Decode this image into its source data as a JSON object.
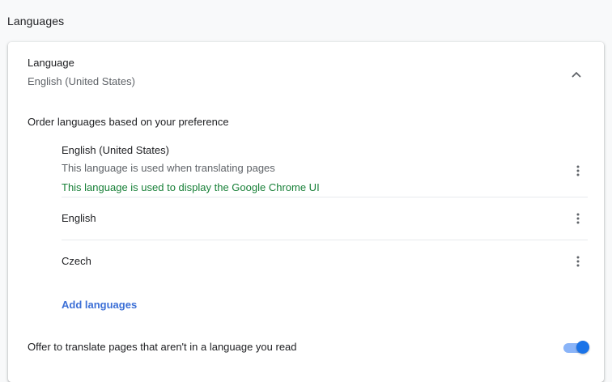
{
  "section": {
    "title": "Languages"
  },
  "language": {
    "label": "Language",
    "current": "English (United States)",
    "collapse_icon": "chevron-up-icon"
  },
  "order": {
    "label": "Order languages based on your preference",
    "items": [
      {
        "name": "English (United States)",
        "desc1": "This language is used when translating pages",
        "desc2": "This language is used to display the Google Chrome UI"
      },
      {
        "name": "English"
      },
      {
        "name": "Czech"
      }
    ],
    "more_icon": "more-vert-icon",
    "add_label": "Add languages"
  },
  "translate": {
    "label": "Offer to translate pages that aren't in a language you read",
    "enabled": true
  },
  "colors": {
    "accent": "#1a73e8",
    "link": "#3c6fd6",
    "success_text": "#188038",
    "secondary_text": "#5f6368"
  }
}
